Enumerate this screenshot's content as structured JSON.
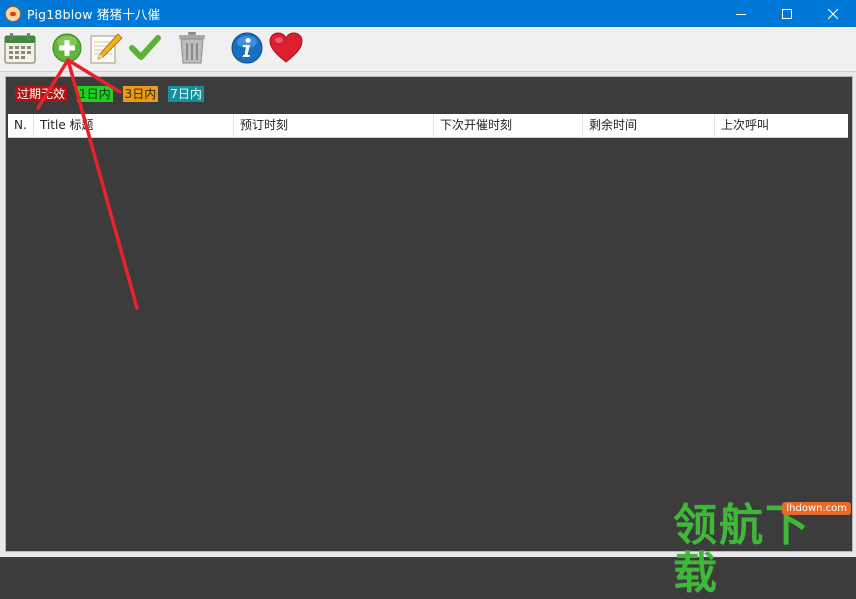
{
  "window": {
    "title": "Pig18blow 猪猪十八催"
  },
  "toolbar": {
    "buttons": [
      {
        "name": "calendar",
        "icon": "calendar-icon"
      },
      {
        "name": "add",
        "icon": "plus-circle-icon"
      },
      {
        "name": "edit",
        "icon": "pencil-icon"
      },
      {
        "name": "confirm",
        "icon": "checkmark-icon"
      },
      {
        "name": "delete",
        "icon": "trash-icon"
      },
      {
        "name": "info",
        "icon": "info-icon"
      },
      {
        "name": "favorite",
        "icon": "heart-icon"
      }
    ]
  },
  "legend": {
    "expired": "过期无效",
    "within_1_day": "1日内",
    "within_3_days": "3日内",
    "within_7_days": "7日内"
  },
  "table": {
    "columns": [
      "N.",
      "Title 标题",
      "预订时刻",
      "下次开催时刻",
      "剩余时间",
      "上次呼叫"
    ],
    "rows": []
  },
  "watermark": {
    "text": "领航下载",
    "url": "lhdown.com"
  },
  "colors": {
    "titlebar": "#0078d7",
    "expired": "#b01212",
    "within_1_day": "#22d022",
    "within_3_days": "#e89a18",
    "within_7_days": "#1a8f9c",
    "annotation_arrow": "#e8222a"
  }
}
